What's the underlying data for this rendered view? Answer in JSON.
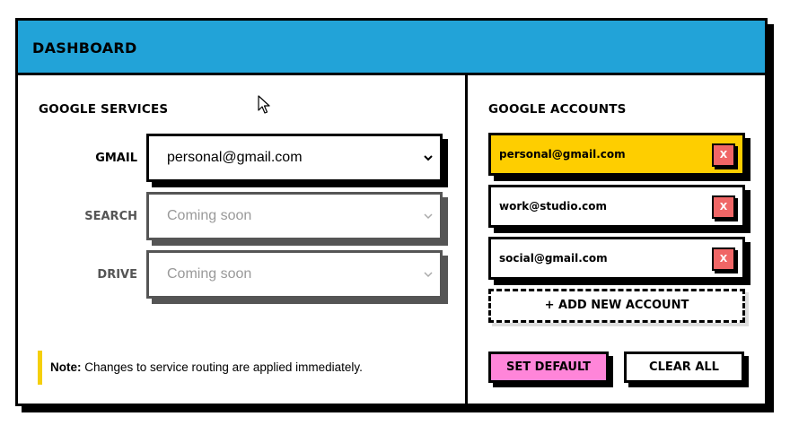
{
  "header": {
    "title": "DASHBOARD"
  },
  "services": {
    "title": "GOOGLE SERVICES",
    "items": [
      {
        "label": "GMAIL",
        "value": "personal@gmail.com",
        "disabled": false
      },
      {
        "label": "SEARCH",
        "value": "Coming soon",
        "disabled": true
      },
      {
        "label": "DRIVE",
        "value": "Coming soon",
        "disabled": true
      }
    ],
    "note_prefix": "Note:",
    "note_text": " Changes to service routing are applied immediately."
  },
  "accounts": {
    "title": "GOOGLE ACCOUNTS",
    "items": [
      {
        "email": "personal@gmail.com",
        "active": true,
        "remove_label": "X"
      },
      {
        "email": "work@studio.com",
        "active": false,
        "remove_label": "X"
      },
      {
        "email": "social@gmail.com",
        "active": false,
        "remove_label": "X"
      }
    ],
    "add_label": "+ ADD NEW ACCOUNT",
    "set_default_label": "SET DEFAULT",
    "clear_all_label": "CLEAR ALL"
  },
  "colors": {
    "header": "#22a3d8",
    "active_account": "#fece00",
    "remove": "#f06666",
    "set_default": "#ff85d9",
    "note_bar": "#f5cf0a"
  },
  "icons": {
    "select": "chevron-down-icon",
    "cursor": "mouse-pointer-icon"
  }
}
